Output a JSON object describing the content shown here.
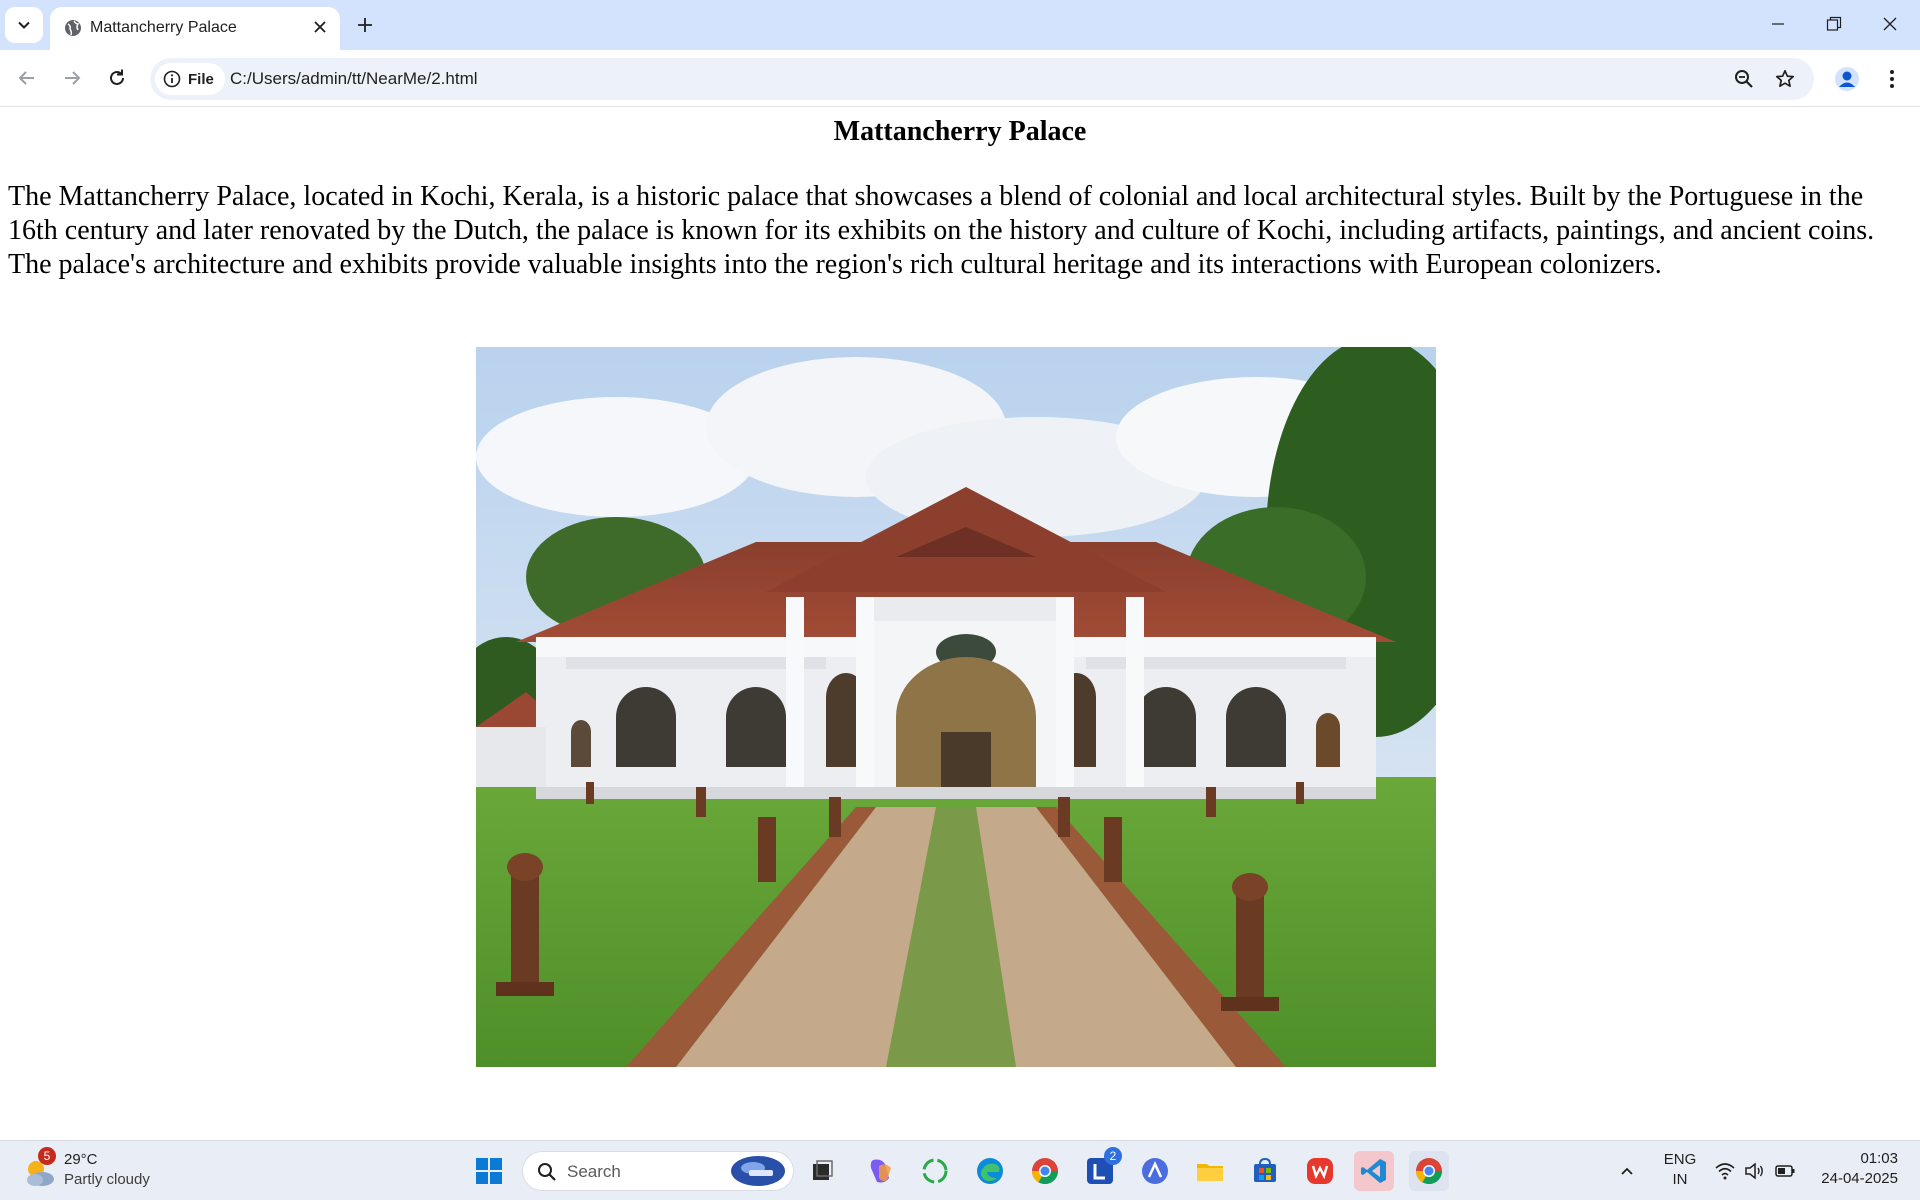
{
  "browser": {
    "tab_title": "Mattancherry Palace",
    "chip_label": "File",
    "url": "C:/Users/admin/tt/NearMe/2.html"
  },
  "page": {
    "heading": "Mattancherry Palace",
    "paragraph": "The Mattancherry Palace, located in Kochi, Kerala, is a historic palace that showcases a blend of colonial and local architectural styles. Built by the Portuguese in the 16th century and later renovated by the Dutch, the palace is known for its exhibits on the history and culture of Kochi, including artifacts, paintings, and ancient coins. The palace's architecture and exhibits provide valuable insights into the region's rich cultural heritage and its interactions with European colonizers."
  },
  "taskbar": {
    "weather_badge": "5",
    "weather_temp": "29°C",
    "weather_desc": "Partly cloudy",
    "search_label": "Search",
    "notification_badge": "2",
    "lang_top": "ENG",
    "lang_bottom": "IN",
    "time": "01:03",
    "date": "24-04-2025"
  },
  "colors": {
    "tabstrip": "#d3e3fd",
    "omnibox": "#edf2fa",
    "taskbar": "#e9eef6"
  }
}
